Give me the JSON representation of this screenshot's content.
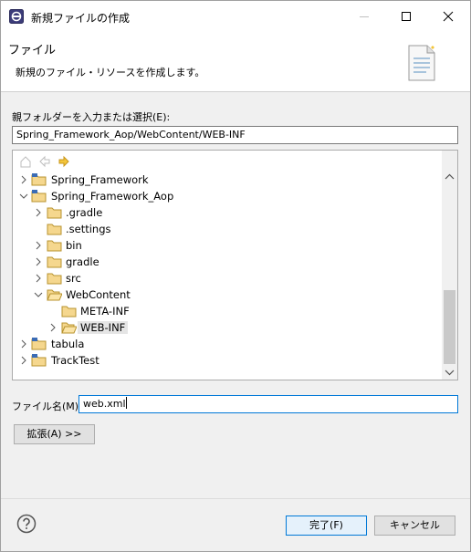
{
  "window": {
    "title": "新規ファイルの作成"
  },
  "banner": {
    "title": "ファイル",
    "description": "新規のファイル・リソースを作成します。"
  },
  "parent_folder": {
    "label": "親フォルダーを入力または選択(E):",
    "value": "Spring_Framework_Aop/WebContent/WEB-INF"
  },
  "tree": {
    "rows": [
      {
        "label": "Spring_Framework",
        "expanded": false,
        "type": "project"
      },
      {
        "label": "Spring_Framework_Aop",
        "expanded": true,
        "type": "project"
      },
      {
        "label": ".gradle",
        "expanded": false,
        "type": "folder"
      },
      {
        "label": ".settings",
        "expanded": null,
        "type": "folder"
      },
      {
        "label": "bin",
        "expanded": false,
        "type": "folder"
      },
      {
        "label": "gradle",
        "expanded": false,
        "type": "folder"
      },
      {
        "label": "src",
        "expanded": false,
        "type": "folder"
      },
      {
        "label": "WebContent",
        "expanded": true,
        "type": "folder-open"
      },
      {
        "label": "META-INF",
        "expanded": null,
        "type": "folder"
      },
      {
        "label": "WEB-INF",
        "expanded": false,
        "type": "folder-open",
        "selected": true
      },
      {
        "label": "tabula",
        "expanded": false,
        "type": "project"
      },
      {
        "label": "TrackTest",
        "expanded": false,
        "type": "project"
      }
    ]
  },
  "file_name": {
    "label": "ファイル名(M):",
    "value": "web.xml"
  },
  "advanced_button": "拡張(A) >>",
  "finish_button": "完了(F)",
  "cancel_button": "キャンセル",
  "colors": {
    "accent": "#0078d7",
    "folder": "#e8b94a",
    "selection": "#e5e5e5"
  }
}
